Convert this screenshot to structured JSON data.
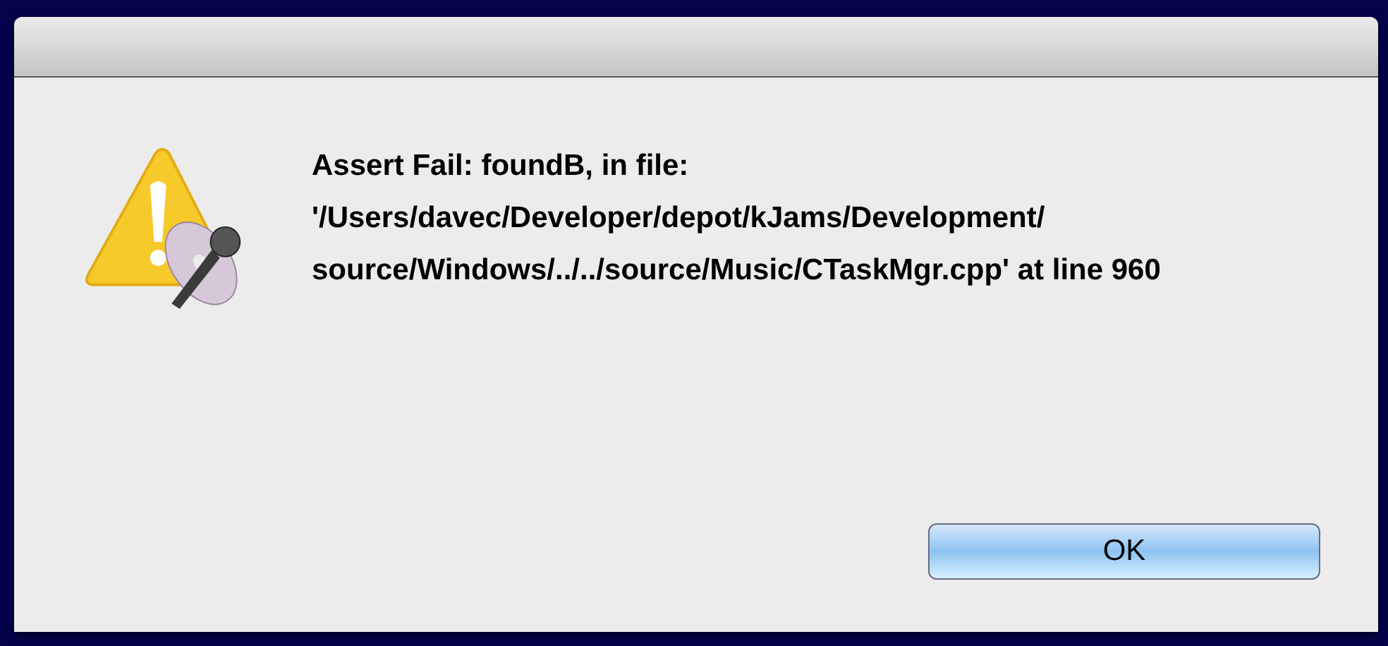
{
  "dialog": {
    "message": "Assert Fail: foundB, in file: '/Users/davec/Developer/depot/kJams/Development/ source/Windows/../../source/Music/CTaskMgr.cpp' at line 960",
    "buttons": [
      {
        "label": "OK",
        "default": true
      }
    ]
  }
}
